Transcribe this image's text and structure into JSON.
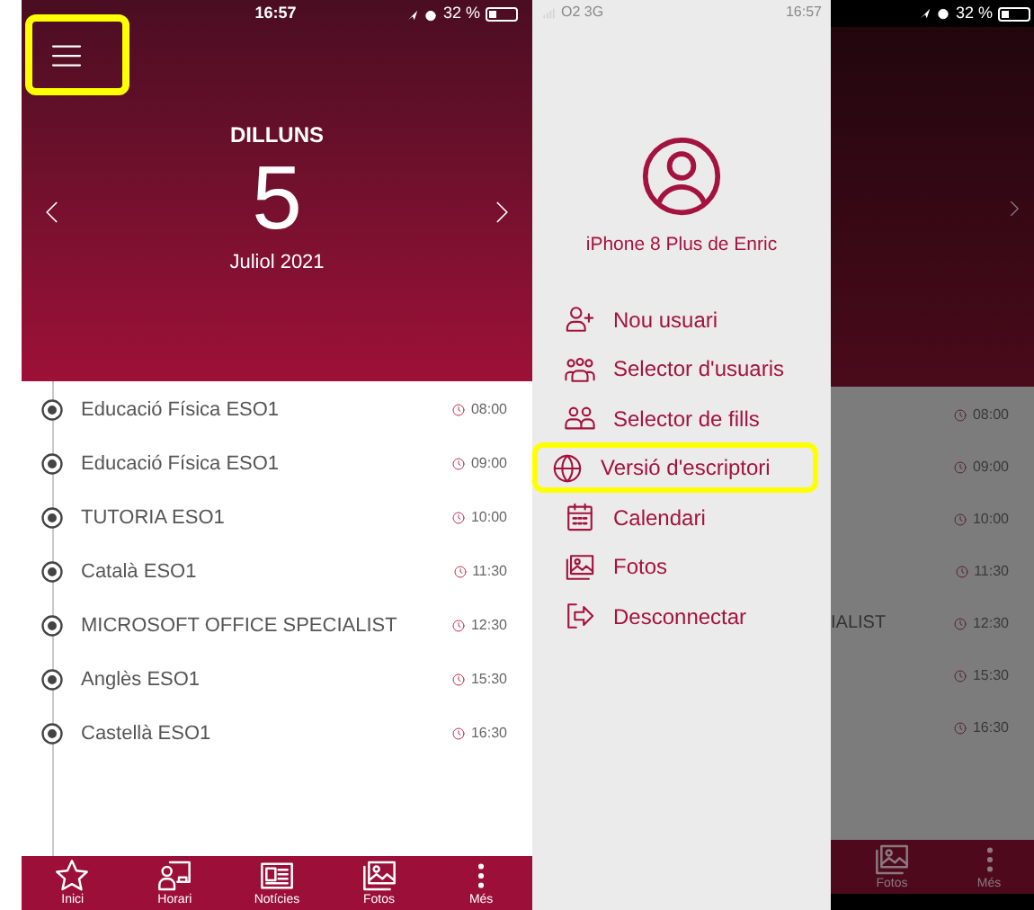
{
  "left_screen": {
    "status_bar": {
      "time": "16:57",
      "battery": "32 %"
    },
    "menu_button": {
      "highlighted": true
    },
    "header": {
      "weekday": "DILLUNS",
      "day": "5",
      "month_year": "Juliol 2021"
    },
    "events": [
      {
        "title": "Educació Física ESO1",
        "time": "08:00"
      },
      {
        "title": "Educació Física ESO1",
        "time": "09:00"
      },
      {
        "title": "TUTORIA ESO1",
        "time": "10:00"
      },
      {
        "title": "Català ESO1",
        "time": "11:30"
      },
      {
        "title": "MICROSOFT OFFICE SPECIALIST",
        "time": "12:30"
      },
      {
        "title": "Anglès ESO1",
        "time": "15:30"
      },
      {
        "title": "Castellà ESO1",
        "time": "16:30"
      }
    ],
    "tab_bar": [
      {
        "label": "Inici"
      },
      {
        "label": "Horari"
      },
      {
        "label": "Notícies"
      },
      {
        "label": "Fotos"
      },
      {
        "label": "Més"
      }
    ]
  },
  "right_screen": {
    "status_bar": {
      "carrier": "O2 3G",
      "time": "16:57",
      "battery": "32 %"
    },
    "drawer": {
      "user_name": "iPhone 8 Plus de Enric",
      "items": [
        {
          "label": "Nou usuari",
          "highlighted": false
        },
        {
          "label": "Selector d'usuaris",
          "highlighted": false
        },
        {
          "label": "Selector de fills",
          "highlighted": false
        },
        {
          "label": "Versió d'escriptori",
          "highlighted": true
        },
        {
          "label": "Calendari",
          "highlighted": false
        },
        {
          "label": "Fotos",
          "highlighted": false
        },
        {
          "label": "Desconnectar",
          "highlighted": false
        }
      ]
    },
    "background": {
      "event_fragment": "IALIST",
      "times": [
        "08:00",
        "09:00",
        "10:00",
        "11:30",
        "12:30",
        "15:30",
        "16:30"
      ],
      "tab_bar": [
        {
          "label": "Fotos"
        },
        {
          "label": "Més"
        }
      ]
    }
  }
}
